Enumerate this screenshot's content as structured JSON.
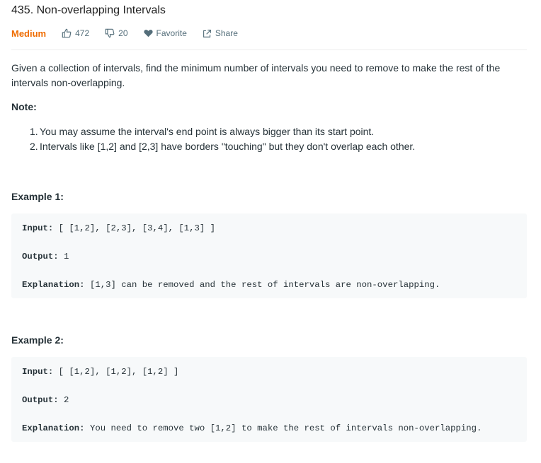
{
  "problem": {
    "title": "435. Non-overlapping Intervals",
    "difficulty": "Medium",
    "likes": "472",
    "dislikes": "20",
    "favorite_label": "Favorite",
    "share_label": "Share"
  },
  "description": "Given a collection of intervals, find the minimum number of intervals you need to remove to make the rest of the intervals non-overlapping.",
  "note": {
    "heading": "Note:",
    "items": [
      {
        "num": "1.",
        "text": "You may assume the interval's end point is always bigger than its start point."
      },
      {
        "num": "2.",
        "text": "Intervals like [1,2] and [2,3] have borders \"touching\" but they don't overlap each other."
      }
    ]
  },
  "examples": [
    {
      "heading": "Example 1:",
      "input_label": "Input:",
      "input_value": " [ [1,2], [2,3], [3,4], [1,3] ]",
      "output_label": "Output:",
      "output_value": " 1",
      "explanation_label": "Explanation:",
      "explanation_value": " [1,3] can be removed and the rest of intervals are non-overlapping."
    },
    {
      "heading": "Example 2:",
      "input_label": "Input:",
      "input_value": " [ [1,2], [1,2], [1,2] ]",
      "output_label": "Output:",
      "output_value": " 2",
      "explanation_label": "Explanation:",
      "explanation_value": " You need to remove two [1,2] to make the rest of intervals non-overlapping."
    }
  ],
  "colors": {
    "difficulty_medium": "#ef6c00",
    "meta_text": "#546e7a",
    "code_bg": "#f7f9fa"
  }
}
